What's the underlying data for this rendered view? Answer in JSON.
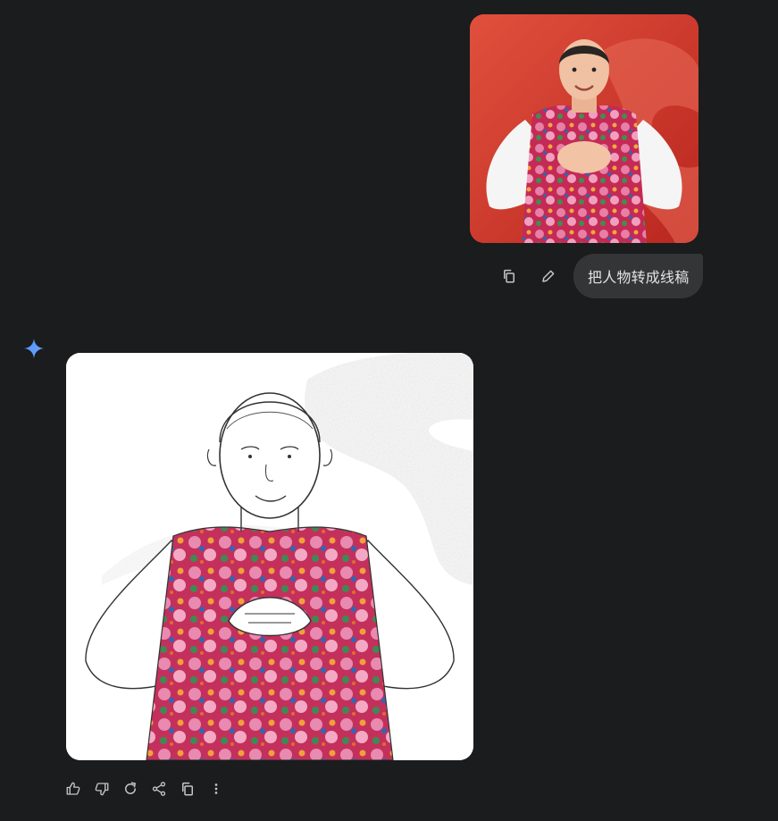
{
  "user_turn": {
    "prompt_text": "把人物转成线稿",
    "actions": [
      {
        "name": "copy-icon"
      },
      {
        "name": "edit-icon"
      }
    ]
  },
  "model_turn": {
    "logo_icon": "gemini-spark-icon",
    "accent_color": "#4e8ef7",
    "actions": [
      {
        "name": "thumbs-up-icon"
      },
      {
        "name": "thumbs-down-icon"
      },
      {
        "name": "regenerate-icon"
      },
      {
        "name": "share-icon"
      },
      {
        "name": "copy-icon"
      },
      {
        "name": "more-vert-icon"
      }
    ]
  },
  "colors": {
    "background": "#1b1c1d",
    "bubble": "#333537",
    "text": "#e3e3e3",
    "icon": "#c4c7c5",
    "photo_backdrop": "#cf3b30"
  }
}
